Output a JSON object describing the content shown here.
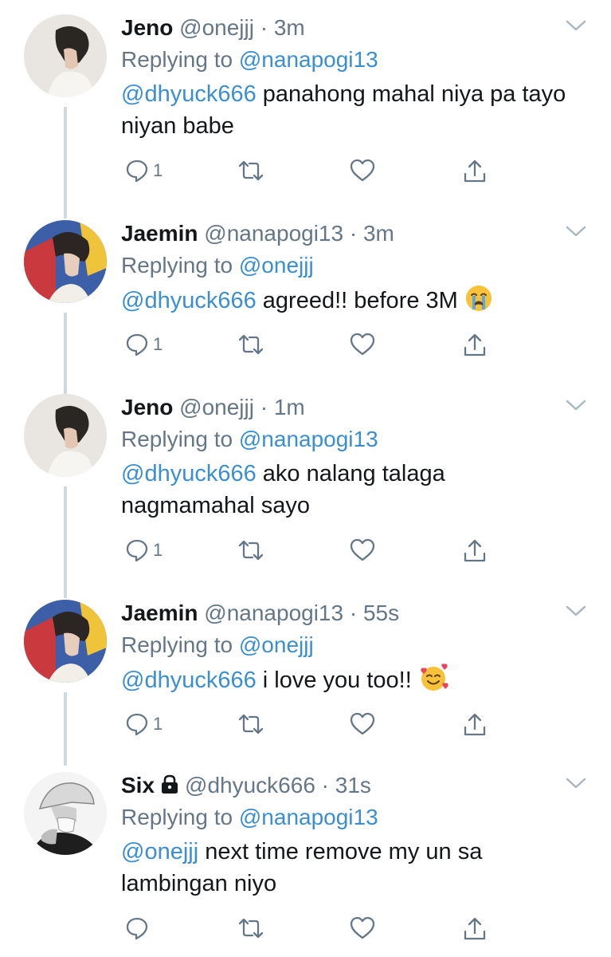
{
  "tweets": [
    {
      "name": "Jeno",
      "handle": "@onejjj",
      "time": "3m",
      "replying_prefix": "Replying to",
      "replying_to": "@nanapogi13",
      "mention": "@dhyuck666",
      "text": " panahong mahal niya pa tayo niyan babe",
      "reply_count": "1",
      "locked": false,
      "emoji": ""
    },
    {
      "name": "Jaemin",
      "handle": "@nanapogi13",
      "time": "3m",
      "replying_prefix": "Replying to",
      "replying_to": "@onejjj",
      "mention": "@dhyuck666",
      "text": " agreed!! before 3M",
      "reply_count": "1",
      "locked": false,
      "emoji": "loudly-crying-face"
    },
    {
      "name": "Jeno",
      "handle": "@onejjj",
      "time": "1m",
      "replying_prefix": "Replying to",
      "replying_to": "@nanapogi13",
      "mention": "@dhyuck666",
      "text": " ako nalang talaga nagmamahal sayo",
      "reply_count": "1",
      "locked": false,
      "emoji": ""
    },
    {
      "name": "Jaemin",
      "handle": "@nanapogi13",
      "time": "55s",
      "replying_prefix": "Replying to",
      "replying_to": "@onejjj",
      "mention": "@dhyuck666",
      "text": " i love you too!!",
      "reply_count": "1",
      "locked": false,
      "emoji": "smiling-face-with-hearts"
    },
    {
      "name": "Six",
      "handle": "@dhyuck666",
      "time": "31s",
      "replying_prefix": "Replying to",
      "replying_to": "@nanapogi13",
      "mention": "@onejjj",
      "text": " next time remove my un sa lambingan niyo",
      "reply_count": "",
      "locked": true,
      "emoji": ""
    }
  ],
  "colors": {
    "link": "#3b8fd0",
    "muted": "#657786",
    "thread_line": "#cfd9de"
  }
}
